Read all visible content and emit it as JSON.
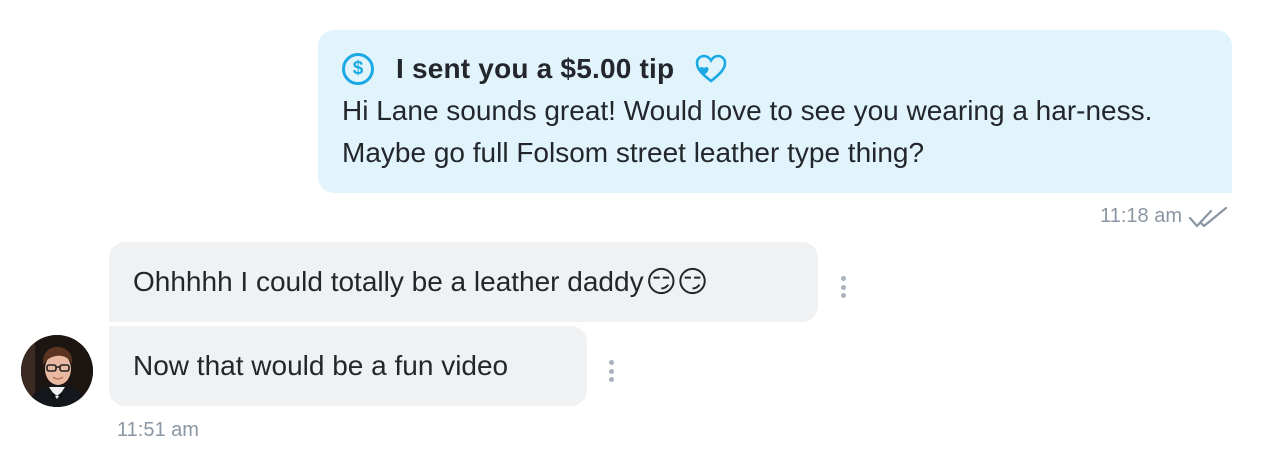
{
  "sent_message": {
    "tip_label": "I sent you a $5.00 tip",
    "dollar_symbol": "$",
    "text": "Hi Lane sounds great! Would love to see you wearing a har-ness. Maybe go full Folsom street leather type thing?",
    "time": "11:18 am",
    "bubble_color": "#e1f4fc",
    "accent_color": "#1aa9e5"
  },
  "received_messages": [
    {
      "text": "Ohhhhh I could totally be a leather daddy",
      "emoji": "😏😏"
    },
    {
      "text": "Now that would be a fun video",
      "emoji": ""
    }
  ],
  "received_time": "11:51 am",
  "icons": {
    "tip": "dollar-circle-icon",
    "heart": "heart-icon",
    "read_receipt": "double-check-icon",
    "options": "more-vertical-icon",
    "avatar": "avatar"
  }
}
